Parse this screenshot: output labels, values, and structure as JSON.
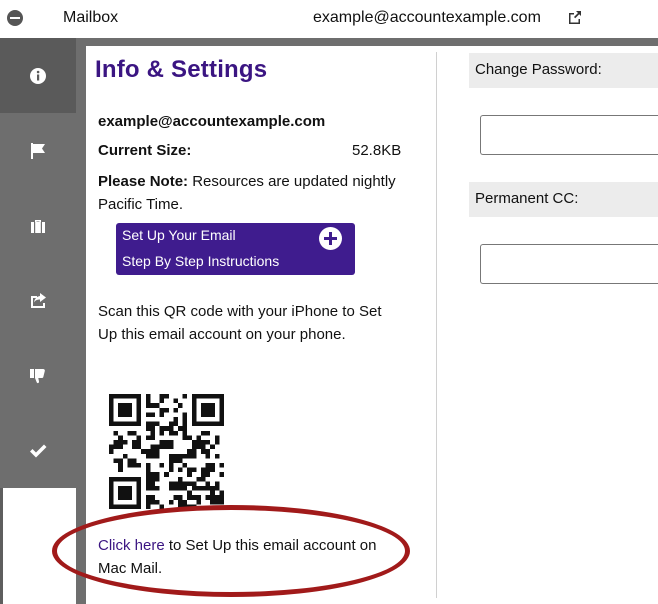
{
  "topbar": {
    "mailbox_label": "Mailbox",
    "account_email": "example@accountexample.com",
    "icons": {
      "collapse": "minus-circle-icon",
      "external_link": "external-link-icon"
    }
  },
  "sidebar": {
    "items": [
      {
        "icon": "info-icon",
        "active": true
      },
      {
        "icon": "flag-icon",
        "active": false
      },
      {
        "icon": "briefcase-icon",
        "active": false
      },
      {
        "icon": "share-icon",
        "active": false
      },
      {
        "icon": "thumbs-down-icon",
        "active": false
      },
      {
        "icon": "checkmark-icon",
        "active": false
      }
    ]
  },
  "info": {
    "title": "Info & Settings",
    "email": "example@accountexample.com",
    "current_size_label": "Current Size:",
    "current_size_value": "52.8KB",
    "note_label": "Please Note:",
    "note_text": " Resources are updated nightly Pacific Time.",
    "setup_button": {
      "line1": "Set Up Your Email",
      "line2": "Step By Step Instructions"
    },
    "scan_text": "Scan this QR code with your iPhone to Set Up this email account on your phone.",
    "mac_link": "Click here",
    "mac_text": " to Set Up this email account on Mac Mail."
  },
  "settings": {
    "change_password_label": "Change Password:",
    "change_password_value": "",
    "permanent_cc_label": "Permanent CC:",
    "permanent_cc_value": ""
  },
  "colors": {
    "brand_purple": "#3b1582",
    "button_purple": "#3f1c8e",
    "sidebar_gray": "#6e6e6e",
    "highlight_red": "#a11a1a"
  }
}
